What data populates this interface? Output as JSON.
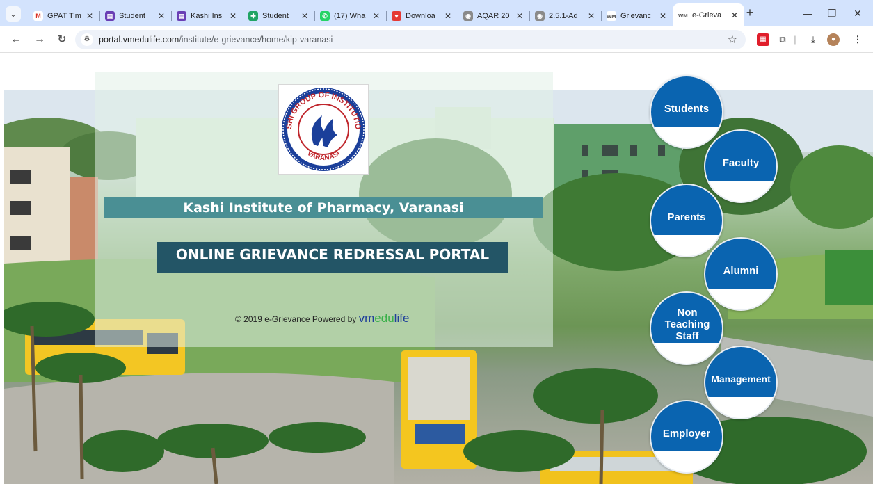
{
  "browser": {
    "tabs": [
      {
        "title": "GPAT Tim",
        "icon": "gmail-icon",
        "color": "#ffffff",
        "glyph": "M"
      },
      {
        "title": "Student",
        "icon": "forms-icon",
        "color": "#6a3fb5",
        "glyph": "▤"
      },
      {
        "title": "Kashi Ins",
        "icon": "forms-icon",
        "color": "#6a3fb5",
        "glyph": "▤"
      },
      {
        "title": "Student",
        "icon": "sheets-icon",
        "color": "#21a464",
        "glyph": "✚"
      },
      {
        "title": "(17) Wha",
        "icon": "whatsapp-icon",
        "color": "#25d366",
        "glyph": "✆"
      },
      {
        "title": "Downloa",
        "icon": "heart-icon",
        "color": "#e53935",
        "glyph": "♥"
      },
      {
        "title": "AQAR 20",
        "icon": "globe-icon",
        "color": "#8a8a8a",
        "glyph": "◉"
      },
      {
        "title": "2.5.1-Ad",
        "icon": "globe-icon",
        "color": "#8a8a8a",
        "glyph": "◉"
      },
      {
        "title": "Grievanc",
        "icon": "vm-icon",
        "color": "#ffffff",
        "glyph": "ᴡᴍ"
      },
      {
        "title": "e-Grieva",
        "icon": "vm-icon",
        "color": "#ffffff",
        "glyph": "ᴡᴍ",
        "active": true
      }
    ],
    "url_host": "portal.vmedulife.com",
    "url_path": "/institute/e-grievance/home/kip-varanasi"
  },
  "page": {
    "institute_name": "Kashi Institute of Pharmacy, Varanasi",
    "portal_title": "ONLINE GRIEVANCE REDRESSAL PORTAL",
    "copyright": "© 2019 e-Grievance Powered by",
    "brand_vm": "vm",
    "brand_edu": "edu",
    "brand_life": "life",
    "logo_ring_top": "KASHI GROUP OF INSTITUTIONS",
    "logo_ring_bottom": "VARANASI",
    "stakeholders": [
      {
        "label": "Students",
        "accent": "#0a64b0"
      },
      {
        "label": "Faculty",
        "accent": "#0a64b0"
      },
      {
        "label": "Parents",
        "accent": "#0a64b0"
      },
      {
        "label": "Alumni",
        "accent": "#0a64b0"
      },
      {
        "label": "Non Teaching Staff",
        "accent": "#0a64b0"
      },
      {
        "label": "Management",
        "accent": "#0a64b0"
      },
      {
        "label": "Employer",
        "accent": "#0a64b0"
      }
    ]
  }
}
